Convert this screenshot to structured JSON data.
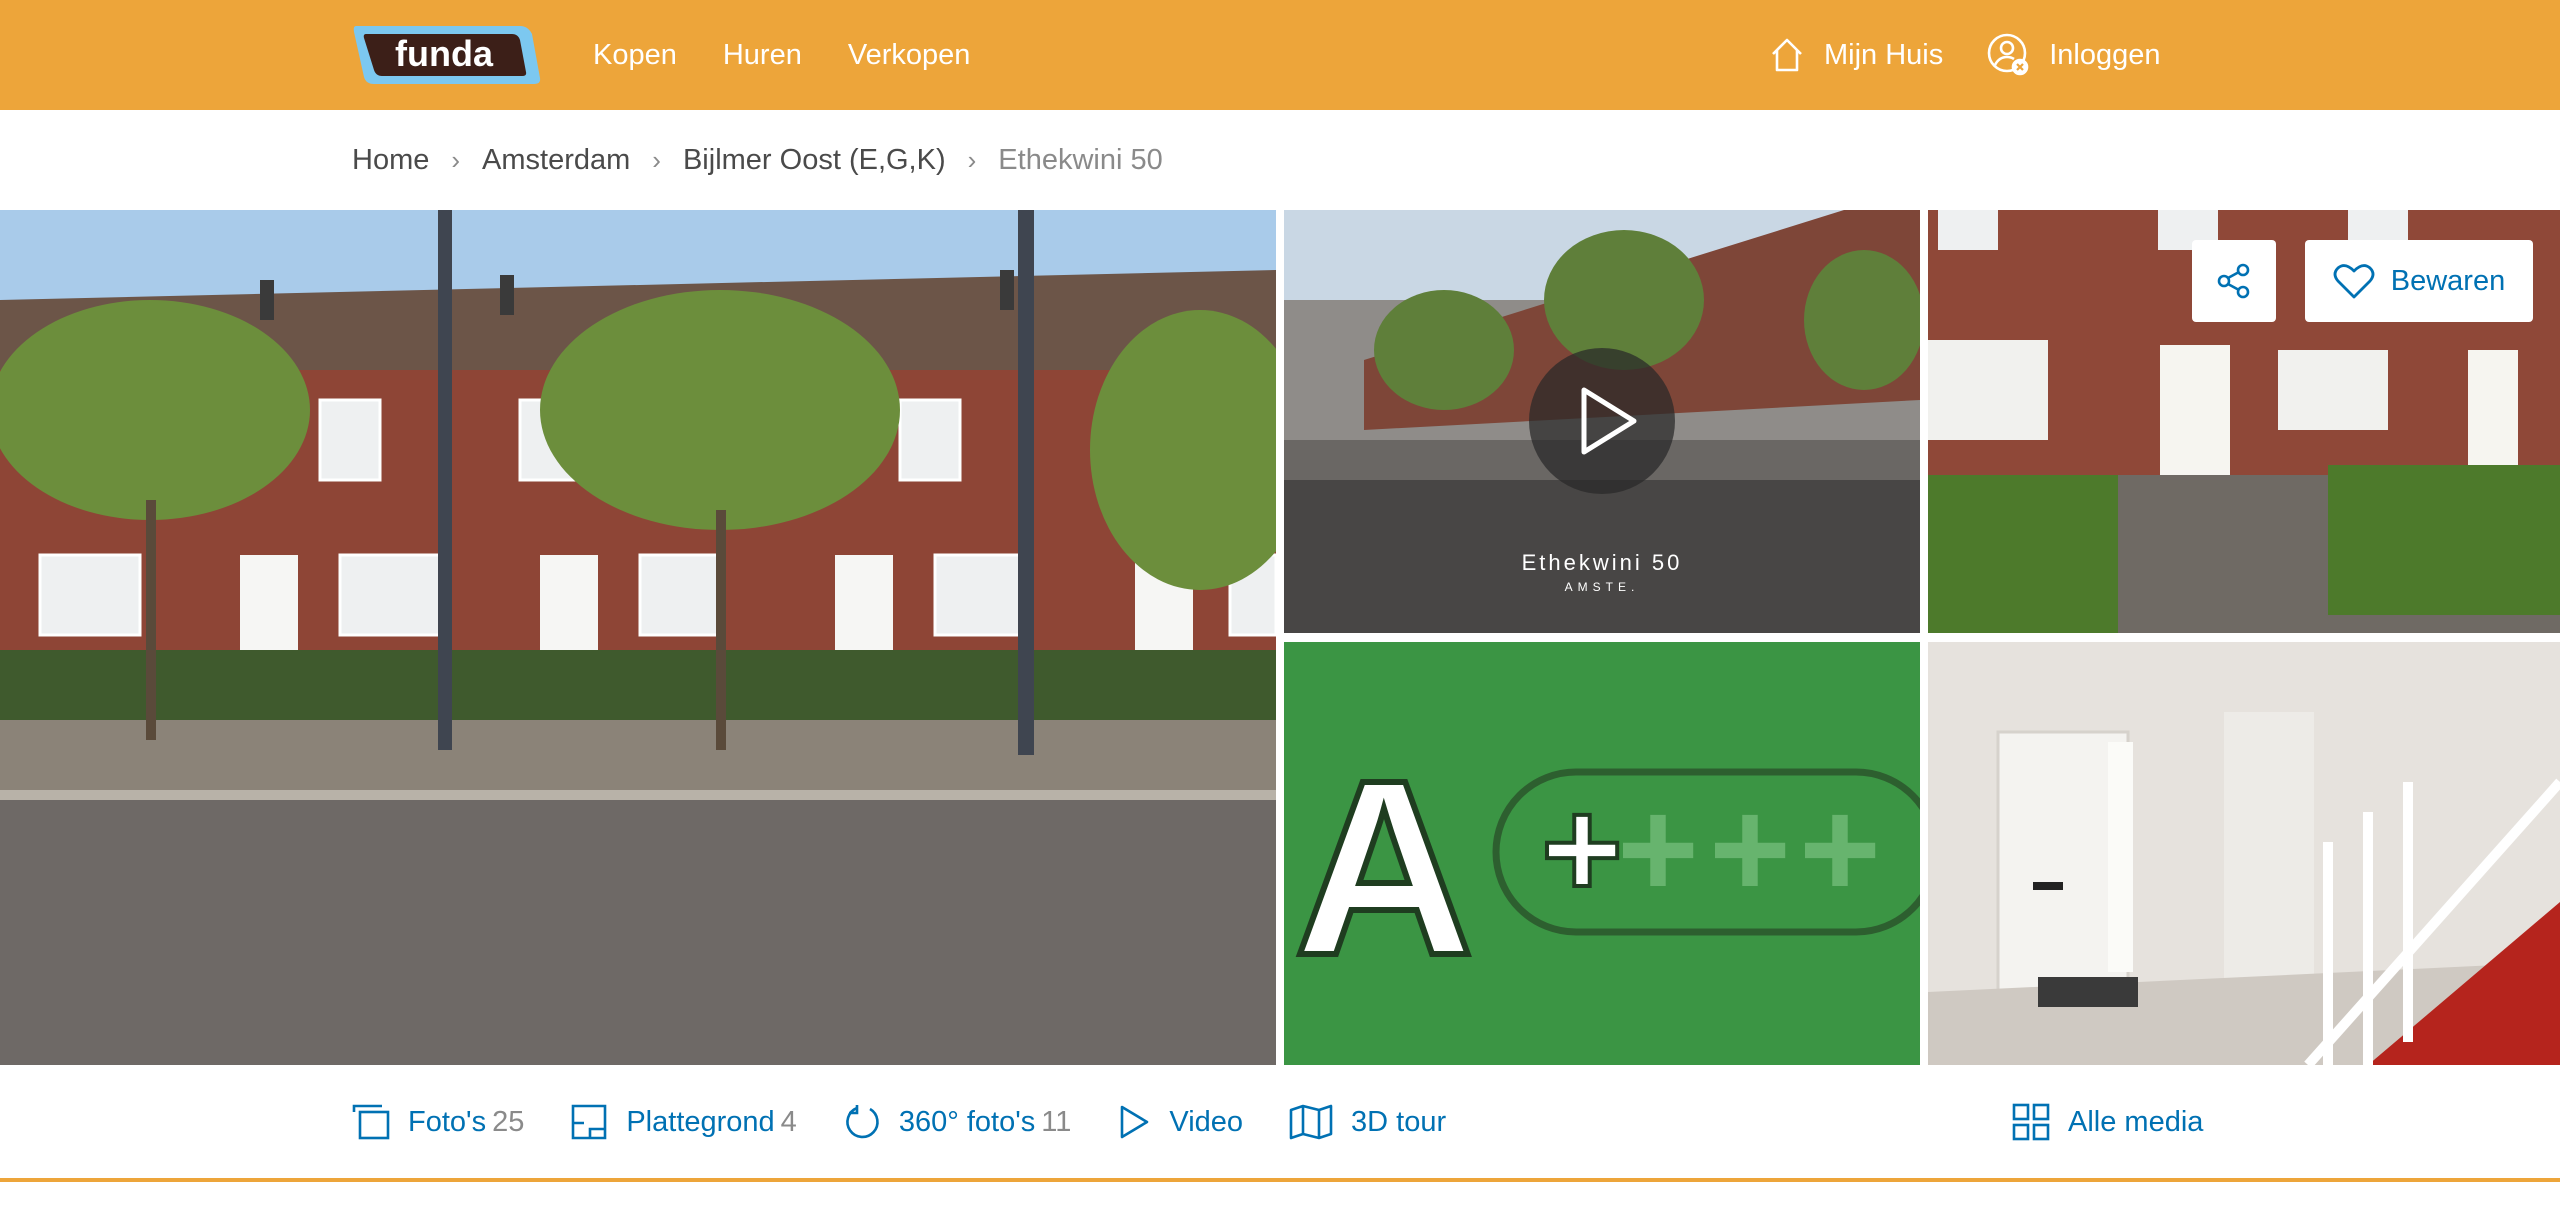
{
  "header": {
    "logo_text": "funda",
    "nav": [
      "Kopen",
      "Huren",
      "Verkopen"
    ],
    "mijn_huis": "Mijn Huis",
    "login": "Inloggen"
  },
  "breadcrumb": {
    "items": [
      "Home",
      "Amsterdam",
      "Bijlmer Oost (E,G,K)"
    ],
    "current": "Ethekwini 50"
  },
  "media": {
    "video_title": "Ethekwini 50",
    "video_subtitle": "AMSTE.",
    "energy_label": "A",
    "energy_plus": "+"
  },
  "actions": {
    "save": "Bewaren"
  },
  "media_tabs": [
    {
      "label": "Foto's",
      "count": "25",
      "icon": "photos-icon"
    },
    {
      "label": "Plattegrond",
      "count": "4",
      "icon": "floorplan-icon"
    },
    {
      "label": "360° foto's",
      "count": "11",
      "icon": "rotate-360-icon"
    },
    {
      "label": "Video",
      "count": "",
      "icon": "play-icon"
    },
    {
      "label": "3D tour",
      "count": "",
      "icon": "map-3d-icon"
    }
  ],
  "all_media": "Alle media",
  "colors": {
    "brand": "#EDA53A",
    "link": "#0071B3",
    "energy_green": "#3B9544"
  }
}
